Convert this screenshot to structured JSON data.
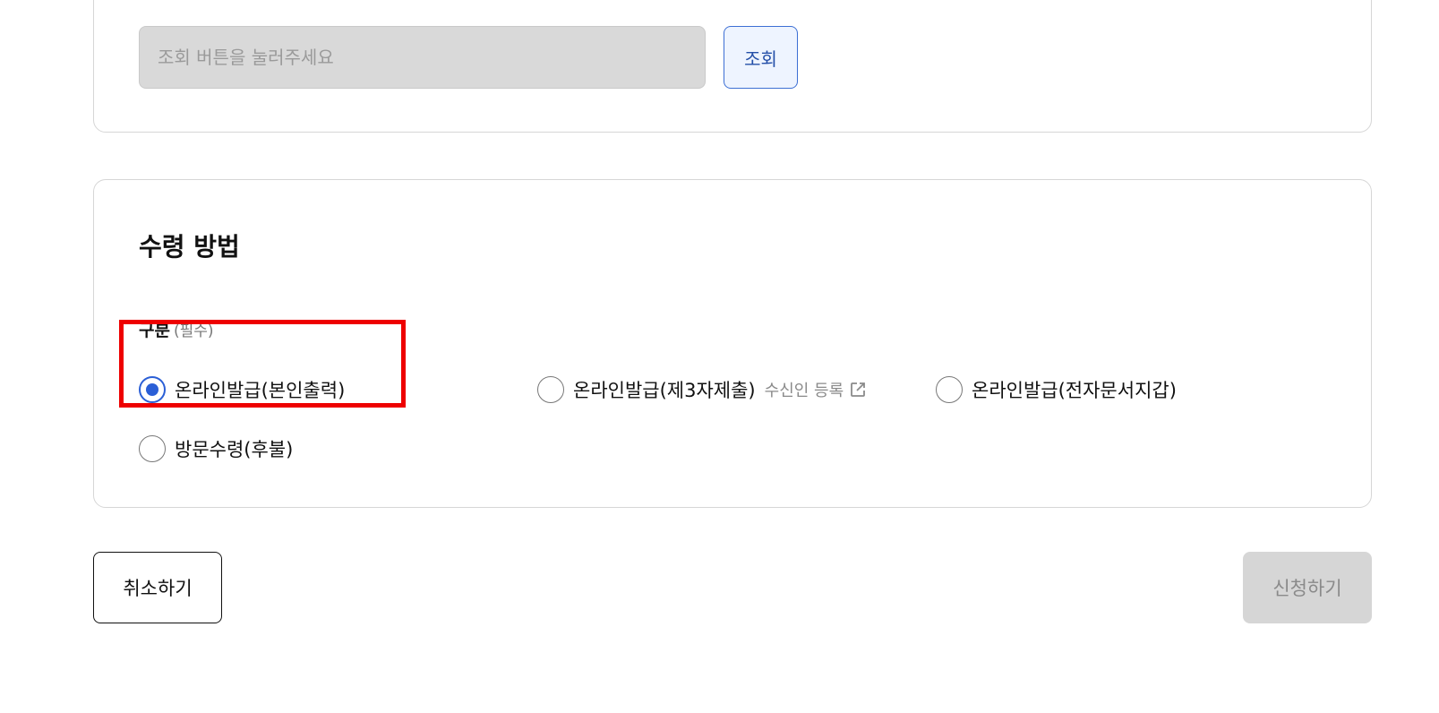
{
  "lookup": {
    "placeholder": "조회 버튼을 눌러주세요",
    "button_label": "조회"
  },
  "receive_method": {
    "title": "수령 방법",
    "field_label": "구분",
    "required_label": "(필수)",
    "options": [
      {
        "label": "온라인발급(본인출력)",
        "checked": true
      },
      {
        "label": "온라인발급(제3자제출)",
        "checked": false,
        "link_label": "수신인 등록",
        "link_icon": "external-link-icon"
      },
      {
        "label": "온라인발급(전자문서지갑)",
        "checked": false
      },
      {
        "label": "방문수령(후불)",
        "checked": false
      }
    ]
  },
  "actions": {
    "cancel_label": "취소하기",
    "apply_label": "신청하기"
  },
  "colors": {
    "accent": "#2b5fd6",
    "highlight": "#ee0000",
    "disabled_bg": "#d6d6d6"
  }
}
